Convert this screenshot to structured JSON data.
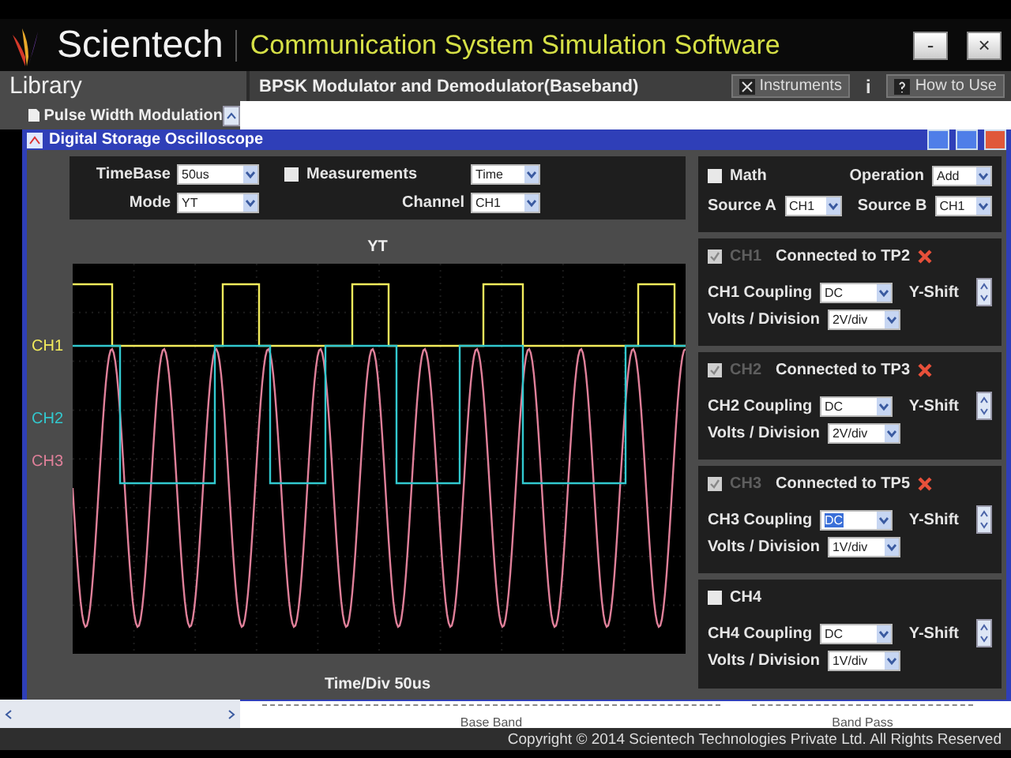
{
  "header": {
    "brand": "Scientech",
    "title": "Communication System Simulation Software",
    "minimize": "-",
    "close": "×"
  },
  "library": {
    "title": "Library",
    "items": [
      {
        "label": "Pulse Width Modulation"
      }
    ]
  },
  "experiment": {
    "title": "BPSK Modulator and Demodulator(Baseband)",
    "buttons": [
      {
        "kind": "instruments",
        "label": "Instruments"
      },
      {
        "kind": "info",
        "label": "i"
      },
      {
        "kind": "help",
        "label": "How to Use"
      }
    ]
  },
  "scope_window": {
    "title": "Digital Storage Oscilloscope"
  },
  "controls": {
    "timebase_label": "TimeBase",
    "timebase": "50us",
    "mode_label": "Mode",
    "mode": "YT",
    "measurements_label": "Measurements",
    "measurements_checked": false,
    "measurement": "Time",
    "channel_label": "Channel",
    "channel": "CH1"
  },
  "display": {
    "mode_title": "YT",
    "channel_labels": [
      "CH1",
      "CH2",
      "CH3"
    ],
    "time_div": "Time/Div 50us"
  },
  "math": {
    "label": "Math",
    "checked": false,
    "operation_label": "Operation",
    "operation": "Add",
    "source_a_label": "Source A",
    "source_a": "CH1",
    "source_b_label": "Source B",
    "source_b": "CH1"
  },
  "channels": [
    {
      "name": "CH1",
      "checked": true,
      "disabled": true,
      "connection": "Connected to TP2",
      "coupling_label": "CH1 Coupling",
      "coupling": "DC",
      "coupling_focused": false,
      "volts_label": "Volts / Division",
      "volts": "2V/div",
      "yshift_label": "Y-Shift"
    },
    {
      "name": "CH2",
      "checked": true,
      "disabled": true,
      "connection": "Connected to TP3",
      "coupling_label": "CH2 Coupling",
      "coupling": "DC",
      "coupling_focused": false,
      "volts_label": "Volts / Division",
      "volts": "2V/div",
      "yshift_label": "Y-Shift"
    },
    {
      "name": "CH3",
      "checked": true,
      "disabled": true,
      "connection": "Connected to TP5",
      "coupling_label": "CH3 Coupling",
      "coupling": "DC",
      "coupling_focused": true,
      "volts_label": "Volts / Division",
      "volts": "1V/div",
      "yshift_label": "Y-Shift"
    },
    {
      "name": "CH4",
      "checked": false,
      "disabled": false,
      "coupling_label": "CH4 Coupling",
      "coupling": "DC",
      "coupling_focused": false,
      "volts_label": "Volts / Division",
      "volts": "1V/div",
      "yshift_label": "Y-Shift"
    }
  ],
  "bottom_labels": [
    "Base Band",
    "Band Pass"
  ],
  "copyright": "Copyright © 2014 Scientech Technologies Private Ltd. All Rights Reserved"
}
